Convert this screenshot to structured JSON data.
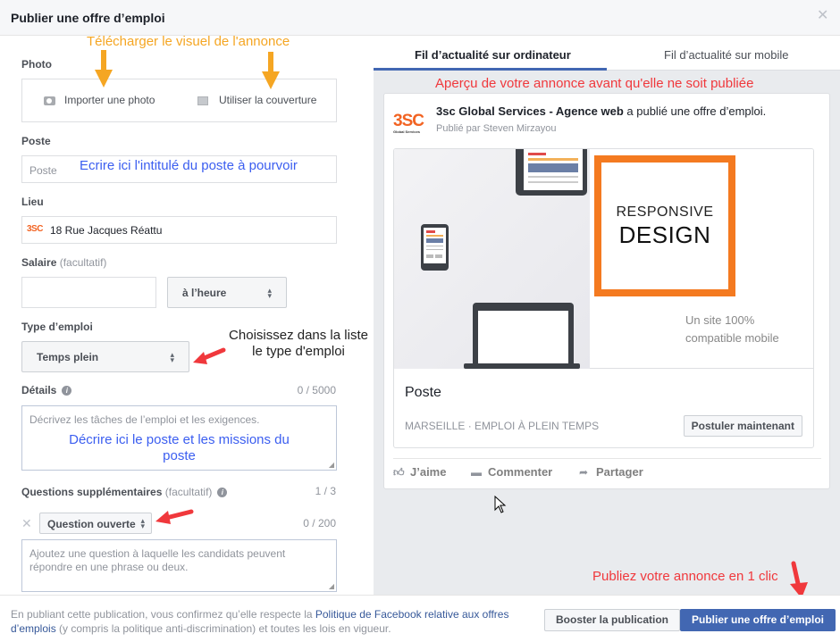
{
  "dialog": {
    "title": "Publier une offre d’emploi",
    "close_icon": "close-icon"
  },
  "form": {
    "photo": {
      "label": "Photo",
      "upload_label": "Importer une photo",
      "upload_icon": "camera-icon",
      "cover_label": "Utiliser la couverture",
      "cover_icon": "image-icon"
    },
    "poste": {
      "label": "Poste",
      "placeholder": "Poste",
      "value": ""
    },
    "lieu": {
      "label": "Lieu",
      "value": "18 Rue Jacques Réattu",
      "logo_text": "3SC"
    },
    "salaire": {
      "label": "Salaire",
      "optional": "(facultatif)",
      "value": "",
      "period_selected": "à l’heure"
    },
    "type_emploi": {
      "label": "Type d’emploi",
      "selected": "Temps plein"
    },
    "details": {
      "label": "Détails",
      "counter": "0 / 5000",
      "placeholder": "Décrivez les tâches de l’emploi et les exigences."
    },
    "questions": {
      "label": "Questions supplémentaires",
      "optional": "(facultatif)",
      "counter": "1 / 3",
      "type_selected": "Question ouverte",
      "question_counter": "0 / 200",
      "placeholder": "Ajoutez une question à laquelle les candidats peuvent répondre en une phrase ou deux."
    }
  },
  "annotations": {
    "photo": "Télécharger le visuel de l'annonce",
    "poste": "Ecrire ici l'intitulé du poste à pourvoir",
    "type_line1": "Choisissez dans la liste",
    "type_line2": "le type d'emploi",
    "details_line1": "Décrire ici le poste et les missions du",
    "details_line2": "poste",
    "preview": "Aperçu de votre annonce avant qu'elle ne soit publiée",
    "publish": "Publiez votre annonce en 1 clic"
  },
  "preview": {
    "tabs": [
      {
        "label": "Fil d’actualité sur ordinateur",
        "active": true
      },
      {
        "label": "Fil d’actualité sur mobile",
        "active": false
      }
    ],
    "page_name": "3sc Global Services - Agence web",
    "action_text": " a publié une offre d’emploi.",
    "published_by": "Publié par Steven Mirzayou",
    "logo_main": "3SC",
    "logo_sub": "Global Services",
    "banner": {
      "line1": "RESPONSIVE",
      "line2": "DESIGN",
      "sub1": "Un site 100%",
      "sub2": "compatible mobile"
    },
    "job_title": "Poste",
    "job_meta": "MARSEILLE · EMPLOI À PLEIN TEMPS",
    "apply_label": "Postuler maintenant",
    "actions": {
      "like": "J’aime",
      "comment": "Commenter",
      "share": "Partager"
    }
  },
  "footer": {
    "note_before": "En publiant cette publication, vous confirmez qu’elle respecte la ",
    "policy_link": "Politique de Facebook relative aux offres d’emplois",
    "note_after": " (y compris la politique anti-discrimination) et toutes les lois en vigueur.",
    "boost_label": "Booster la publication",
    "publish_label": "Publier une offre d’emploi"
  },
  "colors": {
    "accent": "#4267b2",
    "annotation_orange": "#f5a623",
    "annotation_blue": "#3b5ef0",
    "annotation_red": "#f0383c",
    "brand_orange": "#f47a20"
  }
}
